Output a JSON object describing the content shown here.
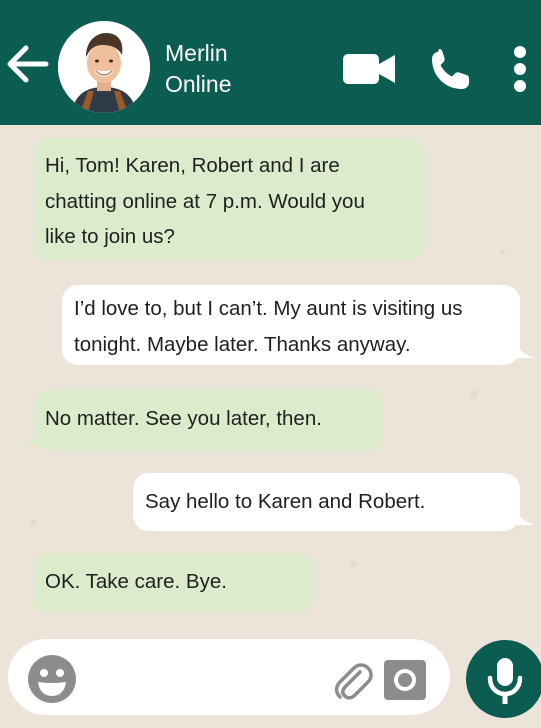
{
  "header": {
    "contact_name": "Merlin",
    "contact_status": "Online",
    "icons": [
      "back-arrow-icon",
      "avatar",
      "video-call-icon",
      "phone-icon",
      "more-vertical-icon"
    ]
  },
  "messages": [
    {
      "direction": "incoming",
      "lines": [
        "Hi, Tom! Karen, Robert and I are",
        "chatting online at 7 p.m. Would you",
        "like to join us?"
      ]
    },
    {
      "direction": "outgoing",
      "lines": [
        "I’d love to, but I can’t. My aunt is visiting us",
        "tonight. Maybe later. Thanks anyway."
      ]
    },
    {
      "direction": "incoming",
      "lines": [
        "No matter. See you later, then."
      ]
    },
    {
      "direction": "outgoing",
      "lines": [
        "Say hello to Karen and Robert."
      ]
    },
    {
      "direction": "incoming",
      "lines": [
        "OK. Take care. Bye."
      ]
    }
  ],
  "input_bar": {
    "icons": [
      "emoji-icon",
      "paperclip-icon",
      "camera-icon",
      "microphone-icon"
    ]
  },
  "colors": {
    "header": "#0b5d52",
    "background": "#ece4d9",
    "incoming_bubble": "#dcebcc",
    "outgoing_bubble": "#ffffff"
  }
}
